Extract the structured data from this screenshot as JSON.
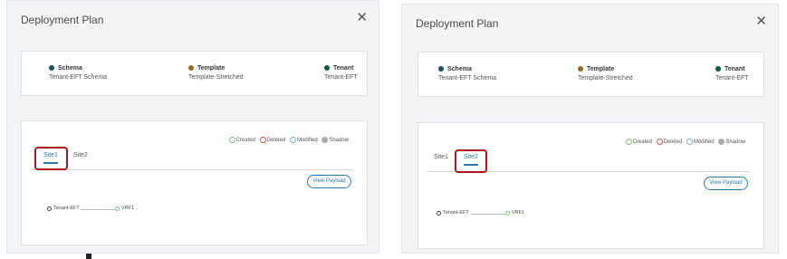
{
  "dialog": {
    "title": "Deployment Plan",
    "close_symbol": "✕"
  },
  "info": {
    "schema_label": "Schema",
    "schema_value": "Tenant-EFT Schema",
    "template_label": "Template",
    "template_value": "Template-Stretched",
    "tenant_label": "Tenant",
    "tenant_value": "Tenant-EFT"
  },
  "legend": {
    "created": "Created",
    "deleted": "Deleted",
    "modified": "Modified",
    "shadow": "Shadow"
  },
  "tabs": {
    "site1": "Site1",
    "site2": "Site2"
  },
  "view_payload": "View Payload",
  "graph": {
    "tenant_node": "Tenant-EFT",
    "vrf_node": "VRF1"
  },
  "colors": {
    "schema_dot": "#1d4f5c",
    "template_dot": "#9a6b23",
    "tenant_dot": "#145a3a",
    "created": "#7cc27b",
    "deleted": "#d9534f",
    "modified": "#7fb4d9",
    "shadow": "#aaaaaa",
    "accent": "#2a7ab0",
    "highlight": "#b0141c"
  },
  "screens": [
    {
      "id": "left",
      "active_tab": "site1"
    },
    {
      "id": "right",
      "active_tab": "site2"
    }
  ]
}
